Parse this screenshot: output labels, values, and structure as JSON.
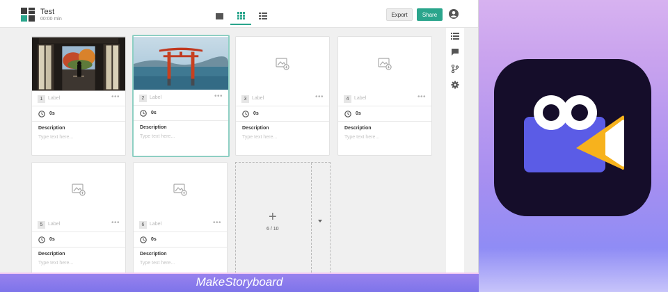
{
  "project": {
    "title": "Test",
    "duration": "00:00 min"
  },
  "toolbar": {
    "export_label": "Export",
    "share_label": "Share"
  },
  "frames": [
    {
      "number": "1",
      "label": "Label",
      "duration": "0s",
      "description_heading": "Description",
      "description_placeholder": "Type text here..."
    },
    {
      "number": "2",
      "label": "Label",
      "duration": "0s",
      "description_heading": "Description",
      "description_placeholder": "Type text here..."
    },
    {
      "number": "3",
      "label": "Label",
      "duration": "0s",
      "description_heading": "Description",
      "description_placeholder": "Type text here..."
    },
    {
      "number": "4",
      "label": "Label",
      "duration": "0s",
      "description_heading": "Description",
      "description_placeholder": "Type text here..."
    },
    {
      "number": "5",
      "label": "Label",
      "duration": "0s",
      "description_heading": "Description",
      "description_placeholder": "Type text here..."
    },
    {
      "number": "6",
      "label": "Label",
      "duration": "0s",
      "description_heading": "Description",
      "description_placeholder": "Type text here..."
    }
  ],
  "add_frame": {
    "plus": "+",
    "count": "6 / 10"
  },
  "more_glyph": "•••",
  "caption": "MakeStoryboard",
  "colors": {
    "accent": "#2aa58c",
    "selected_border": "#8ecfc3",
    "app_icon_bg": "#150d2a",
    "icon_camera": "#5b5ce6",
    "icon_lens": "#f7b21d"
  },
  "icons": [
    "logo-icon",
    "single-view-icon",
    "grid-view-icon",
    "list-view-icon",
    "account-icon",
    "list-icon",
    "comment-icon",
    "branch-icon",
    "gear-icon",
    "clock-icon",
    "image-placeholder-icon",
    "chevron-down-icon"
  ]
}
